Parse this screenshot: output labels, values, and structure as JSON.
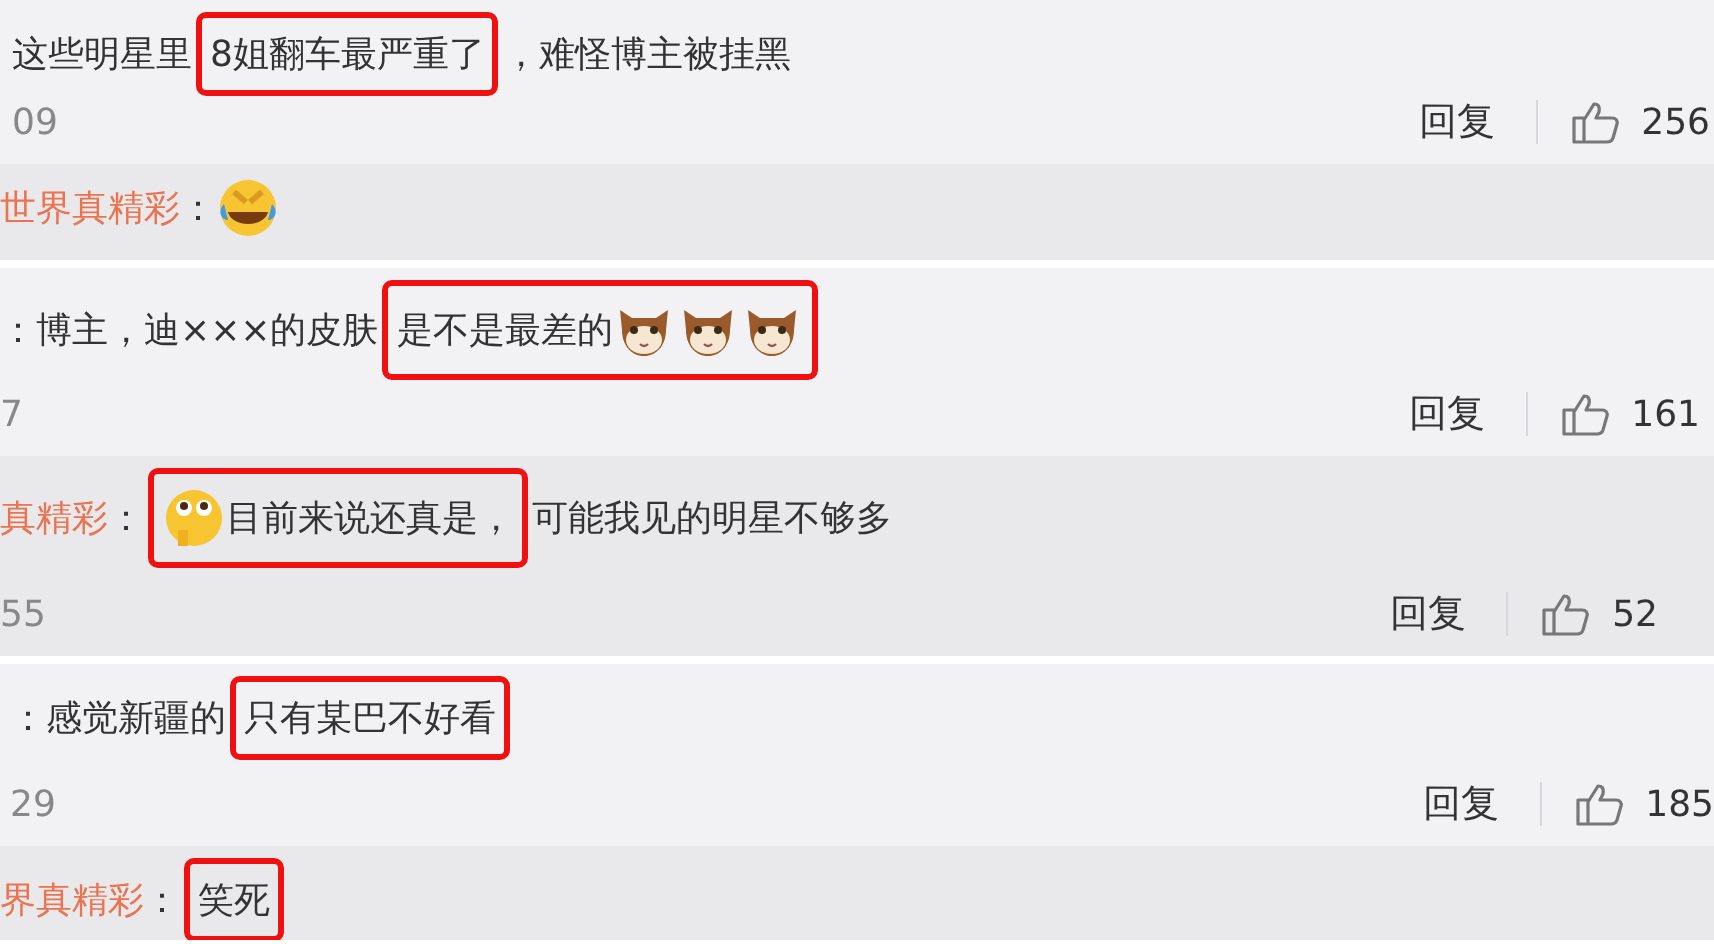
{
  "items": [
    {
      "kind": "comment",
      "content": [
        {
          "boxed": false,
          "parts": [
            {
              "kind": "text",
              "text": "这些明星里"
            }
          ]
        },
        {
          "boxed": true,
          "parts": [
            {
              "kind": "text",
              "text": "8姐翻车最严重了"
            }
          ]
        },
        {
          "boxed": false,
          "parts": [
            {
              "kind": "text",
              "text": "，难怪博主被挂黑"
            }
          ]
        }
      ],
      "time": "09",
      "reply": "回复",
      "likes": "256"
    },
    {
      "kind": "reply",
      "user": "世界真精彩",
      "content": [
        {
          "boxed": false,
          "parts": [
            {
              "kind": "text",
              "text": "："
            },
            {
              "kind": "laugh-emoji"
            }
          ]
        }
      ]
    },
    {
      "kind": "comment",
      "content": [
        {
          "boxed": false,
          "parts": [
            {
              "kind": "text",
              "text": "：博主，迪×××的皮肤"
            }
          ]
        },
        {
          "boxed": true,
          "parts": [
            {
              "kind": "text",
              "text": "是不是最差的"
            },
            {
              "kind": "cat-emoji"
            },
            {
              "kind": "cat-emoji"
            },
            {
              "kind": "cat-emoji"
            }
          ]
        }
      ],
      "time": "7",
      "reply": "回复",
      "likes": "161"
    },
    {
      "kind": "reply",
      "user": "真精彩",
      "content": [
        {
          "boxed": false,
          "parts": [
            {
              "kind": "text",
              "text": "："
            }
          ]
        },
        {
          "boxed": true,
          "parts": [
            {
              "kind": "thinking-emoji"
            },
            {
              "kind": "text",
              "text": "目前来说还真是，"
            }
          ]
        },
        {
          "boxed": false,
          "parts": [
            {
              "kind": "text",
              "text": "可能我见的明星不够多"
            }
          ]
        }
      ],
      "time": "55",
      "reply": "回复",
      "likes": "52"
    },
    {
      "kind": "comment",
      "content": [
        {
          "boxed": false,
          "parts": [
            {
              "kind": "text",
              "text": "：感觉新疆的"
            }
          ]
        },
        {
          "boxed": true,
          "parts": [
            {
              "kind": "text",
              "text": "只有某巴不好看"
            }
          ]
        }
      ],
      "time": "29",
      "reply": "回复",
      "likes": "185"
    },
    {
      "kind": "reply",
      "user": "界真精彩",
      "content": [
        {
          "boxed": false,
          "parts": [
            {
              "kind": "text",
              "text": "："
            }
          ]
        },
        {
          "boxed": true,
          "parts": [
            {
              "kind": "text",
              "text": "笑死"
            }
          ]
        }
      ]
    }
  ]
}
